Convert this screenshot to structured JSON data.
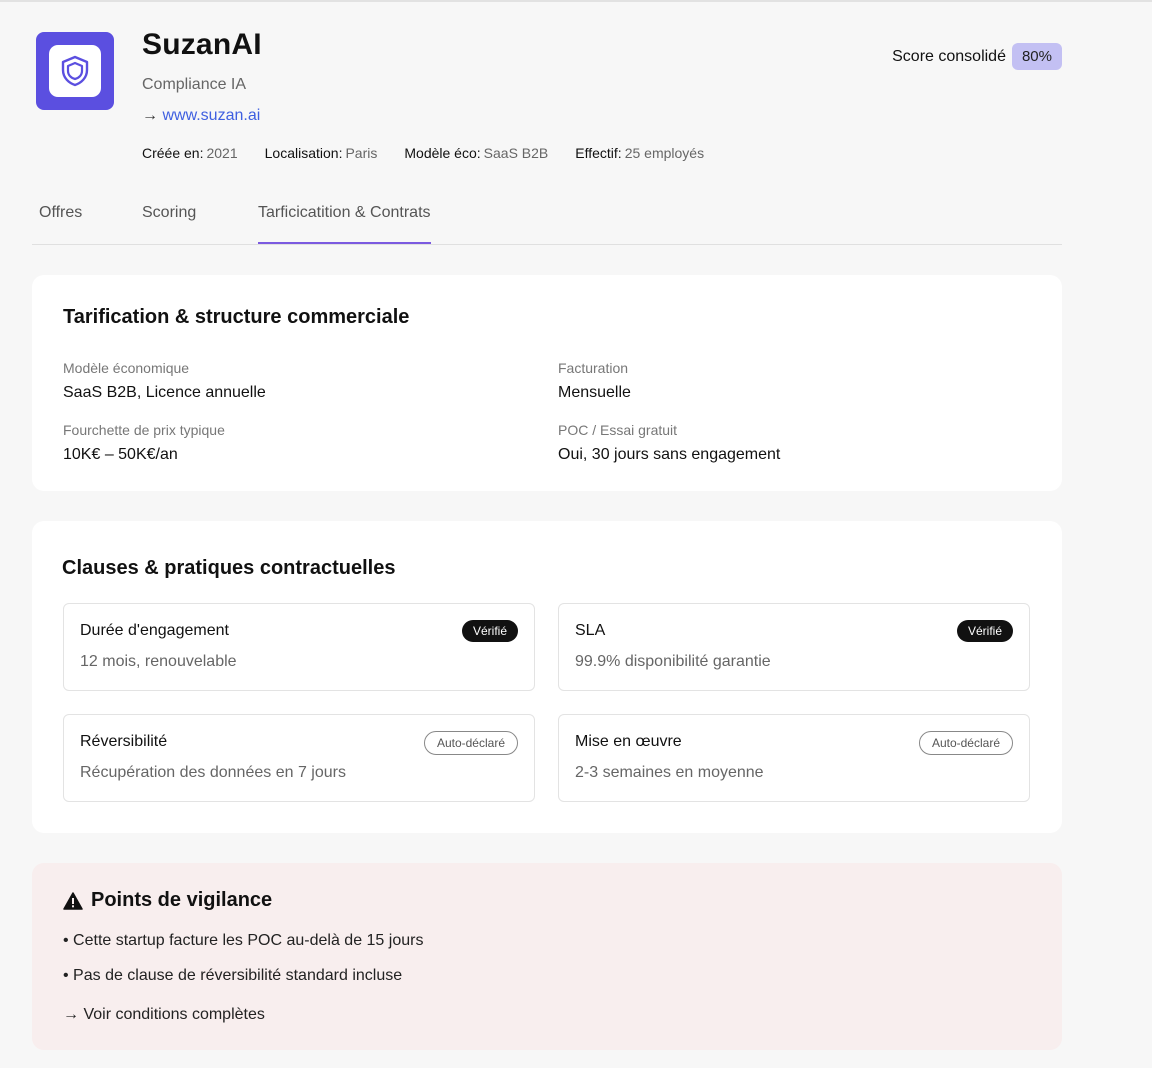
{
  "company": {
    "name": "SuzanAI",
    "tagline": "Compliance IA",
    "website_arrow": "→",
    "website": "www.suzan.ai",
    "meta": [
      {
        "label": "Créée en:",
        "value": "2021"
      },
      {
        "label": "Localisation:",
        "value": "Paris"
      },
      {
        "label": "Modèle éco:",
        "value": "SaaS B2B"
      },
      {
        "label": "Effectif:",
        "value": "25 employés"
      }
    ]
  },
  "score": {
    "label": "Score consolidé",
    "value": "80%"
  },
  "tabs": [
    {
      "label": "Offres"
    },
    {
      "label": "Scoring"
    },
    {
      "label": "Tarficicatition & Contrats",
      "active": true
    }
  ],
  "pricing": {
    "title": "Tarification & structure commerciale",
    "fields": [
      {
        "label": "Modèle économique",
        "value": "SaaS B2B, Licence annuelle"
      },
      {
        "label": "Facturation",
        "value": "Mensuelle"
      },
      {
        "label": "Fourchette de prix typique",
        "value": "10K€ – 50K€/an"
      },
      {
        "label": "POC / Essai gratuit",
        "value": "Oui, 30 jours sans engagement"
      }
    ]
  },
  "clauses": {
    "title": "Clauses & pratiques contractuelles",
    "items": [
      {
        "title": "Durée d'engagement",
        "desc": "12 mois, renouvelable",
        "badge": "Vérifié"
      },
      {
        "title": "SLA",
        "desc": "99.9% disponibilité garantie",
        "badge": "Vérifié"
      },
      {
        "title": "Réversibilité",
        "desc": "Récupération des données en 7 jours",
        "badge": "Auto-déclaré"
      },
      {
        "title": "Mise en œuvre",
        "desc": "2-3 semaines en moyenne",
        "badge": "Auto-déclaré"
      }
    ]
  },
  "vigilance": {
    "title": "Points de vigilance",
    "items": [
      "• Cette startup facture les POC au-delà de 15 jours",
      "• Pas de clause de réversibilité standard incluse"
    ],
    "link": "→ Voir conditions complètes"
  },
  "colors": {
    "brand": "#5b4fe0",
    "tab_active_underline": "#7b5ae0",
    "score_badge": "#c3c0f3",
    "link": "#3f5fe0",
    "alert_bg": "#f8eeee"
  },
  "icons": {
    "logo": "shield-icon",
    "alert": "warning-triangle-icon"
  }
}
